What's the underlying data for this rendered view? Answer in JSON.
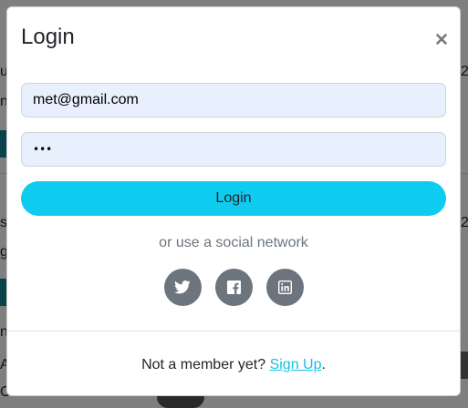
{
  "modal": {
    "title": "Login",
    "close_label": "×",
    "email_value": "met@gmail.com",
    "password_value": "•••",
    "login_button": "Login",
    "social_caption": "or use a social network",
    "social": [
      "twitter-icon",
      "facebook-icon",
      "linkedin-icon"
    ],
    "footer_text": "Not a member yet? ",
    "signup_link": "Sign Up",
    "footer_period": "."
  },
  "colors": {
    "login_button": "#10cbf0",
    "social_button": "#6c757d",
    "input_background": "#e8f0fe",
    "link": "#17c0e8"
  }
}
